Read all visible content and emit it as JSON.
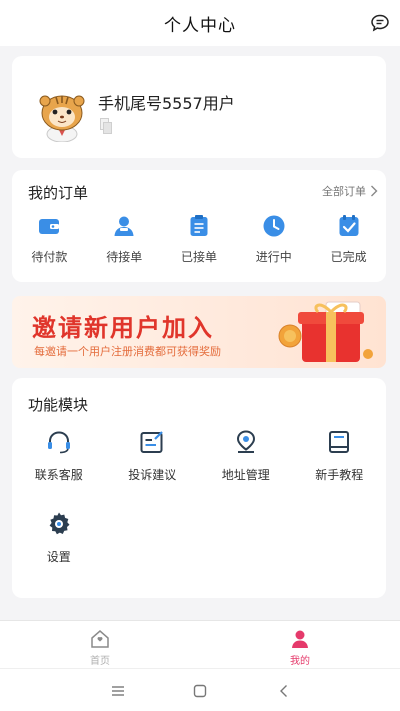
{
  "header": {
    "title": "个人中心",
    "message_icon": "chat-bubble-icon"
  },
  "profile": {
    "username": "手机尾号5557用户",
    "avatar_icon": "hamster-avatar",
    "copy_icon": "copy-icon"
  },
  "orders": {
    "title": "我的订单",
    "all_label": "全部订单",
    "items": [
      {
        "label": "待付款",
        "icon": "wallet-icon"
      },
      {
        "label": "待接单",
        "icon": "person-icon"
      },
      {
        "label": "已接单",
        "icon": "clipboard-icon"
      },
      {
        "label": "进行中",
        "icon": "clock-icon"
      },
      {
        "label": "已完成",
        "icon": "check-icon"
      }
    ]
  },
  "banner": {
    "title": "邀请新用户加入",
    "subtitle": "每邀请一个用户注册消费都可获得奖励"
  },
  "functions": {
    "title": "功能模块",
    "items": [
      {
        "label": "联系客服",
        "icon": "headset-icon"
      },
      {
        "label": "投诉建议",
        "icon": "edit-icon"
      },
      {
        "label": "地址管理",
        "icon": "location-icon"
      },
      {
        "label": "新手教程",
        "icon": "book-icon"
      },
      {
        "label": "设置",
        "icon": "gear-icon"
      }
    ]
  },
  "tabbar": {
    "items": [
      {
        "label": "首页",
        "icon": "home-icon",
        "active": false
      },
      {
        "label": "我的",
        "icon": "user-icon",
        "active": true
      }
    ]
  },
  "colors": {
    "accent": "#3a8ee6",
    "active_tab": "#e53a6b",
    "banner_title": "#e0352b"
  }
}
